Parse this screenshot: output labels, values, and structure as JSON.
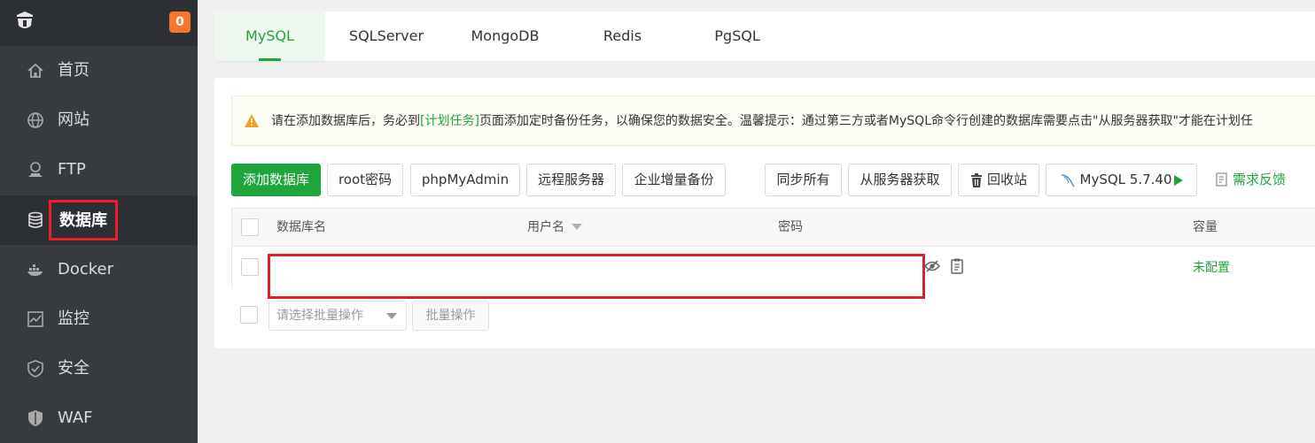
{
  "sidebar": {
    "badge": "0",
    "items": [
      {
        "label": "首页",
        "icon": "home-icon"
      },
      {
        "label": "网站",
        "icon": "globe-icon"
      },
      {
        "label": "FTP",
        "icon": "ftp-icon"
      },
      {
        "label": "数据库",
        "icon": "database-icon"
      },
      {
        "label": "Docker",
        "icon": "docker-icon"
      },
      {
        "label": "监控",
        "icon": "monitor-icon"
      },
      {
        "label": "安全",
        "icon": "shield-icon"
      },
      {
        "label": "WAF",
        "icon": "waf-shield-icon"
      }
    ],
    "active_index": 3
  },
  "tabs": [
    "MySQL",
    "SQLServer",
    "MongoDB",
    "Redis",
    "PgSQL"
  ],
  "notice": {
    "before": "请在添加数据库后，务必到",
    "link": "[计划任务]",
    "after": "页面添加定时备份任务，以确保您的数据安全。温馨提示：通过第三方或者MySQL命令行创建的数据库需要点击\"从服务器获取\"才能在计划任"
  },
  "toolbar": {
    "add_db": "添加数据库",
    "root_pwd": "root密码",
    "phpmyadmin": "phpMyAdmin",
    "remote_server": "远程服务器",
    "enterprise_backup": "企业增量备份",
    "sync_all": "同步所有",
    "get_from_server": "从服务器获取",
    "recycle_bin": "回收站",
    "mysql_version": "MySQL 5.7.40",
    "feedback": "需求反馈"
  },
  "table": {
    "headers": {
      "name": "数据库名",
      "user": "用户名",
      "password": "密码",
      "capacity": "容量"
    },
    "rows": [
      {
        "name": "",
        "user": "",
        "password": "",
        "capacity": "未配置"
      }
    ]
  },
  "batch": {
    "placeholder": "请选择批量操作",
    "button": "批量操作"
  },
  "colors": {
    "accent": "#20a53a",
    "sidebar_bg": "#363b40",
    "badge": "#f7762a",
    "highlight": "#d8232f"
  }
}
